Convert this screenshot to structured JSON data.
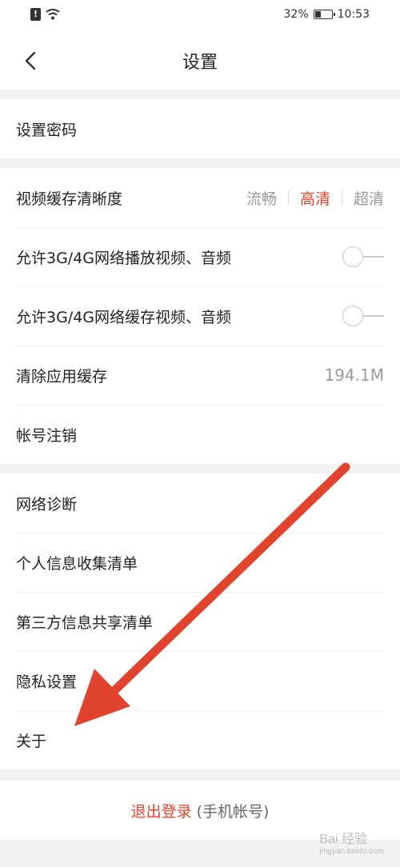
{
  "status_bar": {
    "battery_percent": "32%",
    "time": "10:53",
    "battery_level": 0.32
  },
  "nav": {
    "title": "设置"
  },
  "sections": {
    "password": {
      "label": "设置密码"
    },
    "video_quality": {
      "label": "视频缓存清晰度",
      "options": [
        "流畅",
        "高清",
        "超清"
      ],
      "selected": "高清",
      "accent": "#e0442f"
    },
    "allow_play": {
      "label": "允许3G/4G网络播放视频、音频",
      "enabled": false
    },
    "allow_cache": {
      "label": "允许3G/4G网络缓存视频、音频",
      "enabled": false
    },
    "clear_cache": {
      "label": "清除应用缓存",
      "value": "194.1M"
    },
    "account_cancel": {
      "label": "帐号注销"
    },
    "network_diag": {
      "label": "网络诊断"
    },
    "personal_info": {
      "label": "个人信息收集清单"
    },
    "third_party": {
      "label": "第三方信息共享清单"
    },
    "privacy": {
      "label": "隐私设置"
    },
    "about": {
      "label": "关于"
    }
  },
  "logout": {
    "primary": "退出登录",
    "secondary": "(手机帐号)"
  },
  "watermark": {
    "brand": "Bai 经验",
    "url": "jingyan.baidu.com"
  },
  "annotation_color": "#e0442f"
}
